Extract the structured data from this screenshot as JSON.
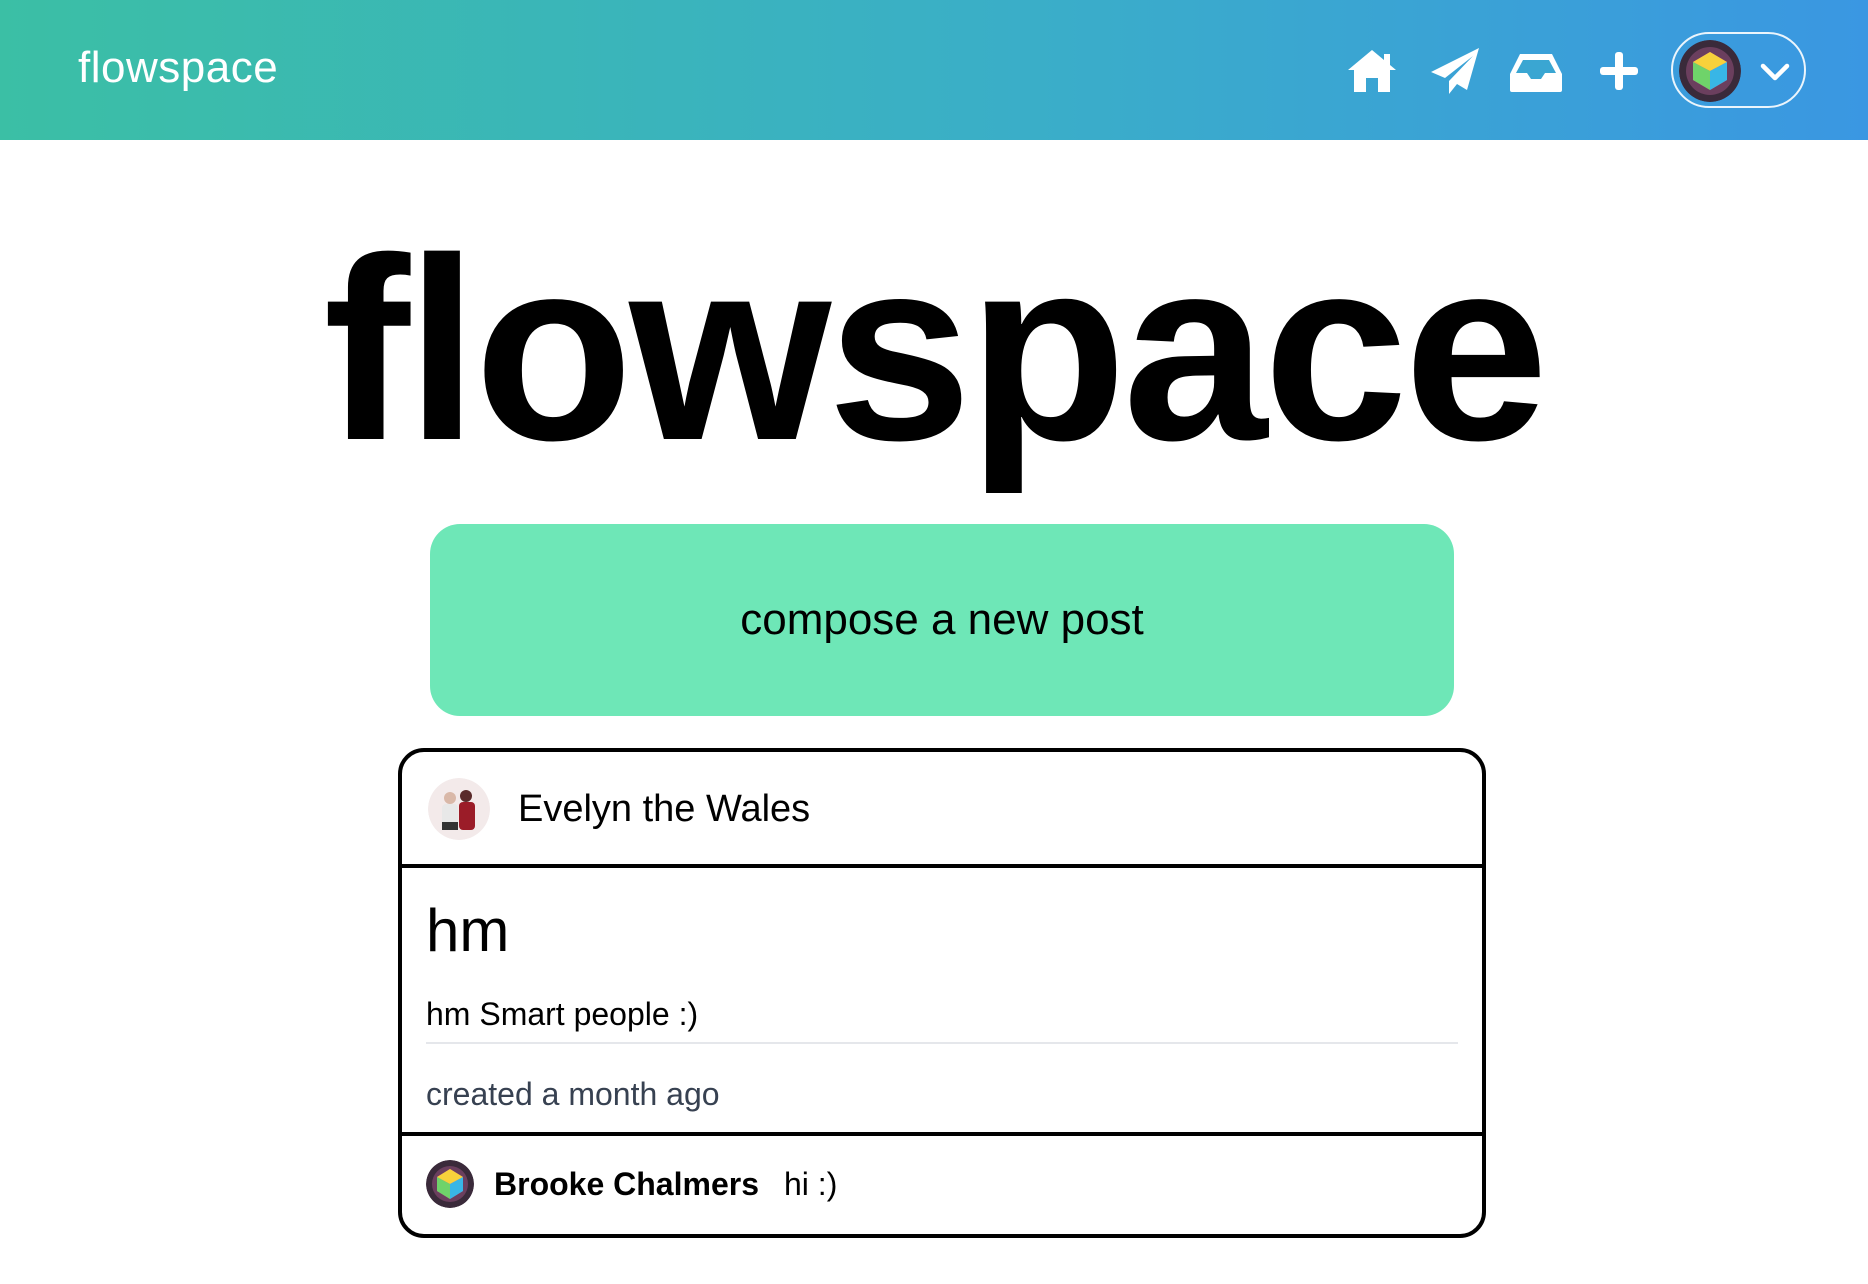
{
  "app": {
    "brand": "flowspace",
    "colors": {
      "header_gradient_start": "#3bbfa5",
      "header_gradient_end": "#3a97e2",
      "compose_button": "#6ee7b7"
    }
  },
  "nav": {
    "icons": [
      "home-icon",
      "paper-plane-icon",
      "inbox-icon",
      "plus-icon"
    ],
    "user_menu_icon": "chevron-down-icon"
  },
  "hero": {
    "title": "flowspace"
  },
  "compose": {
    "label": "compose a new post"
  },
  "post": {
    "author": "Evelyn the Wales",
    "title": "hm",
    "content": "hm Smart people :)",
    "meta": "created a month ago",
    "comments": [
      {
        "author": "Brooke Chalmers",
        "text": "hi :)"
      }
    ]
  }
}
